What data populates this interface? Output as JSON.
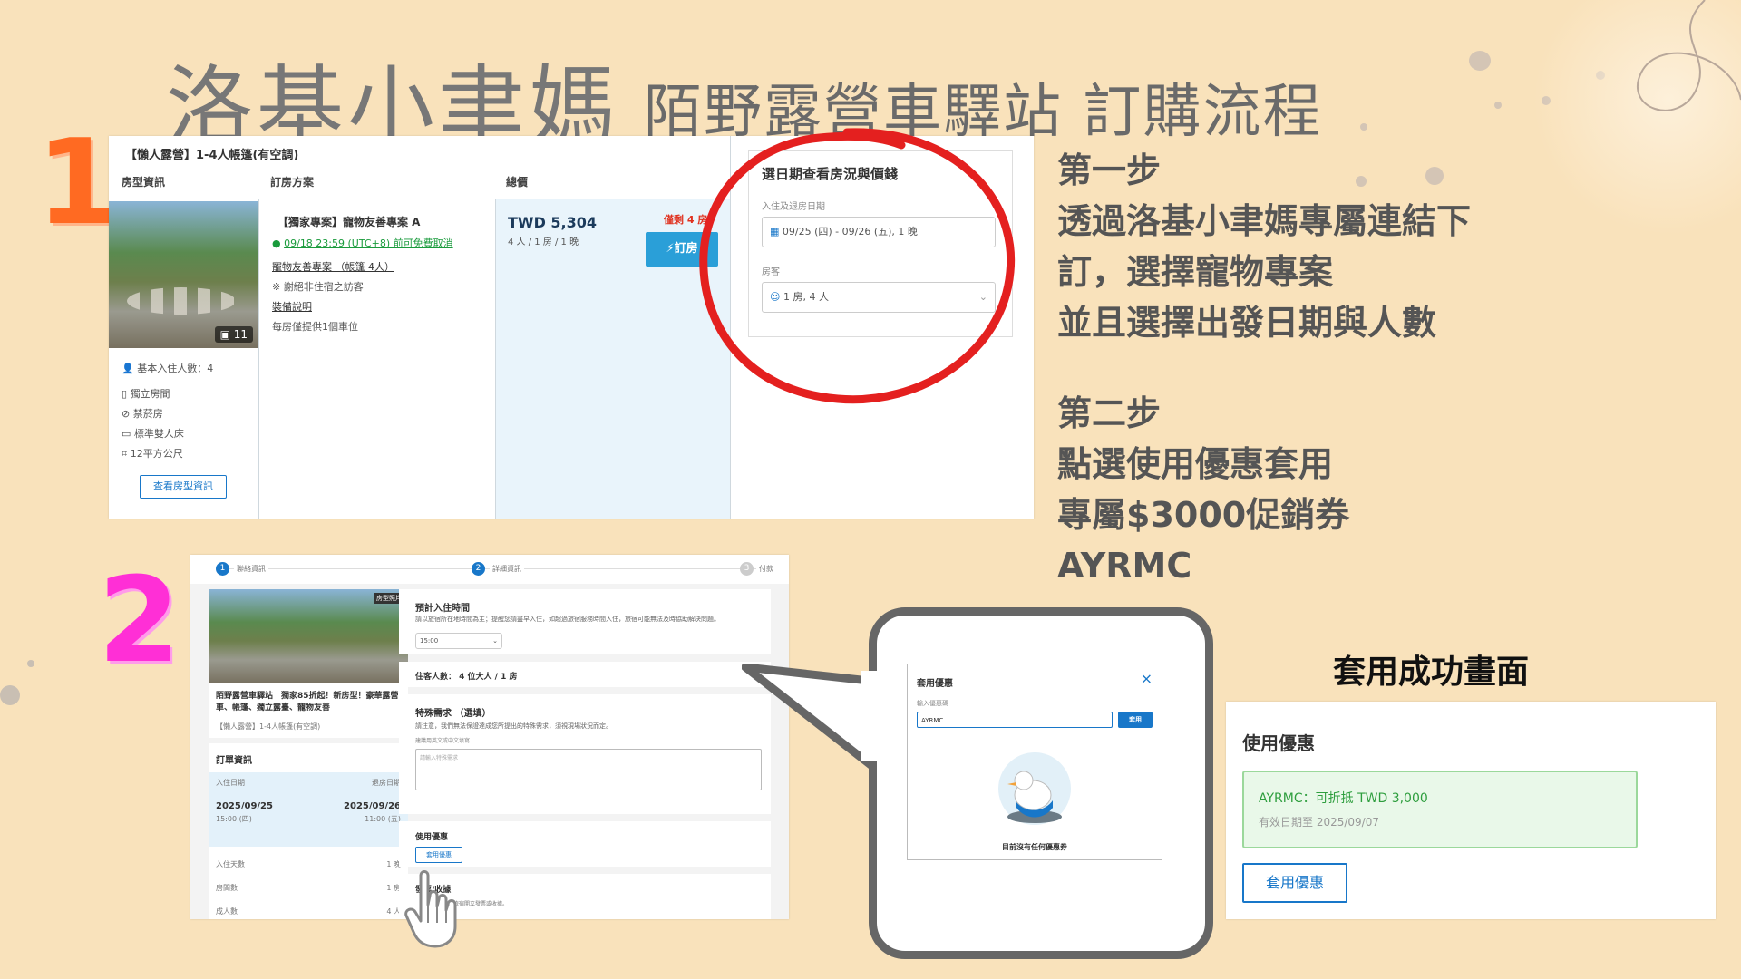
{
  "header": {
    "brand": "洛基小聿媽",
    "subtitle": "陌野露營車驛站 訂購流程"
  },
  "markers": {
    "step1": "1",
    "step2": "2"
  },
  "steps": {
    "step1_title": "第一步",
    "step1_lines": [
      "透過洛基小聿媽專屬連結下",
      "訂，選擇寵物專案",
      "並且選擇出發日期與人數"
    ],
    "step2_title": "第二步",
    "step2_lines": [
      "點選使用優惠套用",
      "專屬$3000促銷券",
      "AYRMC"
    ]
  },
  "booking": {
    "title": "【懶人露營】1-4人帳篷(有空調)",
    "col_room": "房型資訊",
    "col_plan": "訂房方案",
    "col_total": "總價",
    "photo_count": "11",
    "features": [
      "基本入住人數：4",
      "獨立房間",
      "禁菸房",
      "標準雙人床",
      "12平方公尺"
    ],
    "view_room_button": "查看房型資訊",
    "plan_name": "【獨家專案】寵物友善專案 A",
    "free_cancel": "09/18 23:59 (UTC+8) 前可免費取消",
    "plan_link": "寵物友善專案 （帳篷 4人）",
    "no_visitor": "謝絕非住宿之訪客",
    "equipment": "裝備說明",
    "parking": "每房僅提供1個車位",
    "price": "TWD 5,304",
    "price_note": "4 人 / 1 房 / 1 晚",
    "remaining": "僅剩 4 房！",
    "book_button": "訂房",
    "side_title": "選日期查看房況與價錢",
    "date_label": "入住及退房日期",
    "date_value": "09/25 (四) - 09/26 (五), 1 晚",
    "guest_label": "房客",
    "guest_value": "1 房, 4 人"
  },
  "checkout": {
    "steps": [
      "聯絡資訊",
      "詳細資訊",
      "付款"
    ],
    "step_nums": [
      "1",
      "2",
      "3"
    ],
    "photo_tag": "房型照片",
    "hotel_name": "陌野露營車驛站｜獨家85折起！新房型！豪華露營車、帳篷、獨立露臺、寵物友善",
    "room_name": "【懶人露營】1-4人帳篷(有空調)",
    "order_title": "訂單資訊",
    "checkin_label": "入住日期",
    "checkout_label": "退房日期",
    "checkin_date": "2025/09/25",
    "checkin_time": "15:00 (四)",
    "checkout_date": "2025/09/26",
    "checkout_time": "11:00 (五)",
    "rows": [
      {
        "label": "入住天數",
        "value": "1 晚"
      },
      {
        "label": "房間數",
        "value": "1 房"
      },
      {
        "label": "成人數",
        "value": "4 人"
      }
    ],
    "arrival_title": "預計入住時間",
    "arrival_note": "請以旅宿所在地時間為主；提醒您請盡早入住，如超過旅宿服務時間入住，旅宿可能無法及時協助解決問題。",
    "arrival_value": "15:00",
    "guests_line": "住客人數： 4 位大人 / 1 房",
    "special_title": "特殊需求 （選填）",
    "special_note": "請注意，我們無法保證達成您所提出的特殊需求，須視現場狀況而定。",
    "special_hint": "建議用英文或中文填寫",
    "special_placeholder": "請輸入特殊需求",
    "coupon_title": "使用優惠",
    "coupon_button": "套用優惠",
    "receipt_title": "發票/收據",
    "receipt_note": "旅宿開立發票或收據。"
  },
  "coupon_dialog": {
    "title": "套用優惠",
    "close": "×",
    "input_label": "輸入優惠碼",
    "input_value": "AYRMC",
    "apply_button": "套用",
    "empty_text": "目前沒有任何優惠券"
  },
  "success": {
    "heading": "套用成功畫面",
    "panel_title": "使用優惠",
    "coupon_line": "AYRMC：可折抵 TWD 3,000",
    "expiry": "有效日期至 2025/09/07",
    "button": "套用優惠"
  },
  "colors": {
    "background": "#f9e2bb",
    "step1_marker": "#ff6a22",
    "step2_marker": "#ff2fd6",
    "highlight_circle": "#e4201f",
    "link_blue": "#1877c9"
  }
}
